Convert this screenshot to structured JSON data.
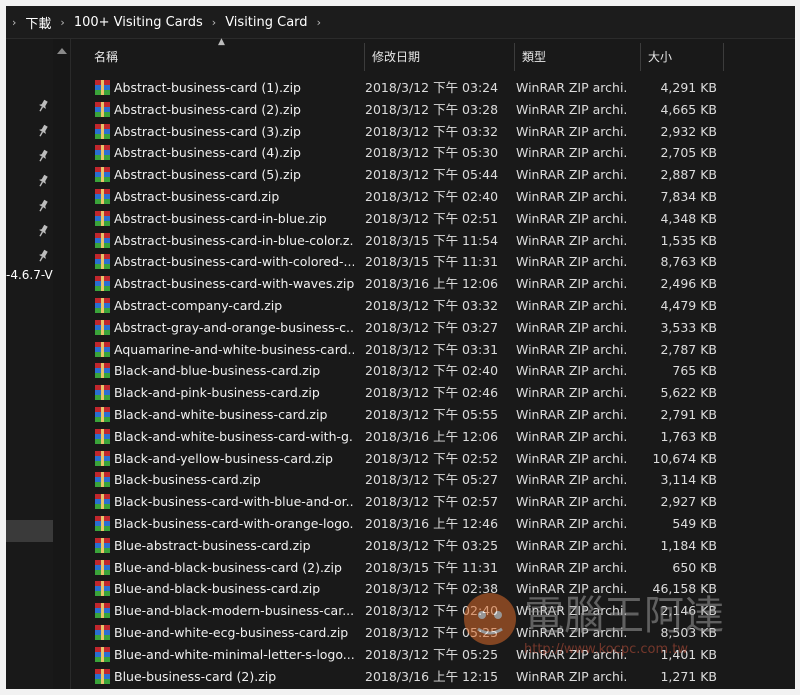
{
  "breadcrumb": {
    "items": [
      "下載",
      "100+ Visiting Cards",
      "Visiting Card"
    ]
  },
  "nav": {
    "partial_text": "-4.6.7-V",
    "pins": 7
  },
  "columns": {
    "name": "名稱",
    "date": "修改日期",
    "type": "類型",
    "size": "大小"
  },
  "files": [
    {
      "name": "Abstract-business-card (1).zip",
      "date": "2018/3/12 下午 03:24",
      "type": "WinRAR ZIP archi...",
      "size": "4,291 KB"
    },
    {
      "name": "Abstract-business-card (2).zip",
      "date": "2018/3/12 下午 03:28",
      "type": "WinRAR ZIP archi...",
      "size": "4,665 KB"
    },
    {
      "name": "Abstract-business-card (3).zip",
      "date": "2018/3/12 下午 03:32",
      "type": "WinRAR ZIP archi...",
      "size": "2,932 KB"
    },
    {
      "name": "Abstract-business-card (4).zip",
      "date": "2018/3/12 下午 05:30",
      "type": "WinRAR ZIP archi...",
      "size": "2,705 KB"
    },
    {
      "name": "Abstract-business-card (5).zip",
      "date": "2018/3/12 下午 05:44",
      "type": "WinRAR ZIP archi...",
      "size": "2,887 KB"
    },
    {
      "name": "Abstract-business-card.zip",
      "date": "2018/3/12 下午 02:40",
      "type": "WinRAR ZIP archi...",
      "size": "7,834 KB"
    },
    {
      "name": "Abstract-business-card-in-blue.zip",
      "date": "2018/3/12 下午 02:51",
      "type": "WinRAR ZIP archi...",
      "size": "4,348 KB"
    },
    {
      "name": "Abstract-business-card-in-blue-color.z...",
      "date": "2018/3/15 下午 11:54",
      "type": "WinRAR ZIP archi...",
      "size": "1,535 KB"
    },
    {
      "name": "Abstract-business-card-with-colored-...",
      "date": "2018/3/15 下午 11:31",
      "type": "WinRAR ZIP archi...",
      "size": "8,763 KB"
    },
    {
      "name": "Abstract-business-card-with-waves.zip",
      "date": "2018/3/16 上午 12:06",
      "type": "WinRAR ZIP archi...",
      "size": "2,496 KB"
    },
    {
      "name": "Abstract-company-card.zip",
      "date": "2018/3/12 下午 03:32",
      "type": "WinRAR ZIP archi...",
      "size": "4,479 KB"
    },
    {
      "name": "Abstract-gray-and-orange-business-c...",
      "date": "2018/3/12 下午 03:27",
      "type": "WinRAR ZIP archi...",
      "size": "3,533 KB"
    },
    {
      "name": "Aquamarine-and-white-business-card....",
      "date": "2018/3/12 下午 03:31",
      "type": "WinRAR ZIP archi...",
      "size": "2,787 KB"
    },
    {
      "name": "Black-and-blue-business-card.zip",
      "date": "2018/3/12 下午 02:40",
      "type": "WinRAR ZIP archi...",
      "size": "765 KB"
    },
    {
      "name": "Black-and-pink-business-card.zip",
      "date": "2018/3/12 下午 02:46",
      "type": "WinRAR ZIP archi...",
      "size": "5,622 KB"
    },
    {
      "name": "Black-and-white-business-card.zip",
      "date": "2018/3/12 下午 05:55",
      "type": "WinRAR ZIP archi...",
      "size": "2,791 KB"
    },
    {
      "name": "Black-and-white-business-card-with-g...",
      "date": "2018/3/16 上午 12:06",
      "type": "WinRAR ZIP archi...",
      "size": "1,763 KB"
    },
    {
      "name": "Black-and-yellow-business-card.zip",
      "date": "2018/3/12 下午 02:52",
      "type": "WinRAR ZIP archi...",
      "size": "10,674 KB"
    },
    {
      "name": "Black-business-card.zip",
      "date": "2018/3/12 下午 05:27",
      "type": "WinRAR ZIP archi...",
      "size": "3,114 KB"
    },
    {
      "name": "Black-business-card-with-blue-and-or...",
      "date": "2018/3/12 下午 02:57",
      "type": "WinRAR ZIP archi...",
      "size": "2,927 KB"
    },
    {
      "name": "Black-business-card-with-orange-logo...",
      "date": "2018/3/16 上午 12:46",
      "type": "WinRAR ZIP archi...",
      "size": "549 KB"
    },
    {
      "name": "Blue-abstract-business-card.zip",
      "date": "2018/3/12 下午 03:25",
      "type": "WinRAR ZIP archi...",
      "size": "1,184 KB"
    },
    {
      "name": "Blue-and-black-business-card (2).zip",
      "date": "2018/3/15 下午 11:31",
      "type": "WinRAR ZIP archi...",
      "size": "650 KB"
    },
    {
      "name": "Blue-and-black-business-card.zip",
      "date": "2018/3/12 下午 02:38",
      "type": "WinRAR ZIP archi...",
      "size": "46,158 KB"
    },
    {
      "name": "Blue-and-black-modern-business-car...",
      "date": "2018/3/12 下午 02:40",
      "type": "WinRAR ZIP archi...",
      "size": "2,146 KB"
    },
    {
      "name": "Blue-and-white-ecg-business-card.zip",
      "date": "2018/3/12 下午 05:25",
      "type": "WinRAR ZIP archi...",
      "size": "8,503 KB"
    },
    {
      "name": "Blue-and-white-minimal-letter-s-logo....",
      "date": "2018/3/12 下午 05:25",
      "type": "WinRAR ZIP archi...",
      "size": "1,401 KB"
    },
    {
      "name": "Blue-business-card (2).zip",
      "date": "2018/3/16 上午 12:15",
      "type": "WinRAR ZIP archi...",
      "size": "1,271 KB"
    }
  ],
  "watermark": {
    "text": "電腦王阿達",
    "url": "http://www.kocpc.com.tw"
  }
}
